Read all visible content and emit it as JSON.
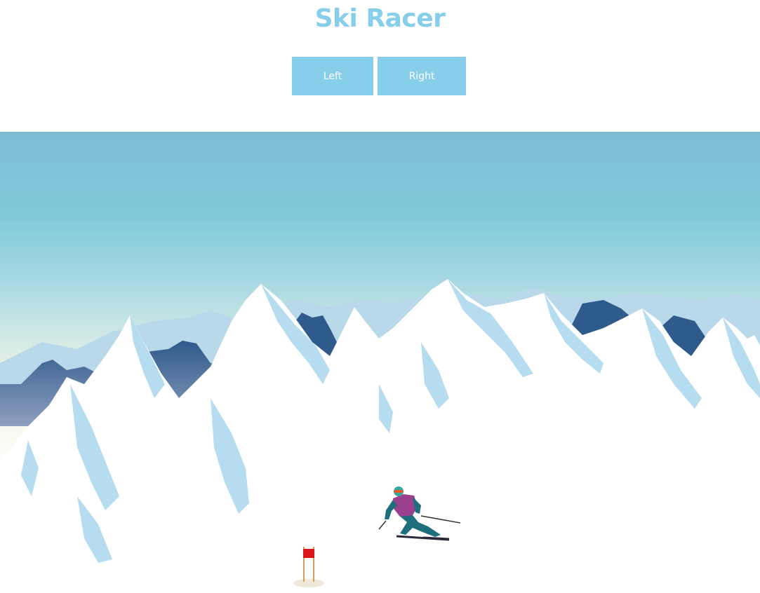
{
  "game": {
    "title": "Ski Racer",
    "controls": {
      "left_label": "Left",
      "right_label": "Right"
    }
  },
  "colors": {
    "accent": "#87ceeb",
    "button_text": "#ffffff",
    "sky_top": "#7fbcd6",
    "sky_mid": "#7fc9da",
    "sky_haze": "#f1f6e3",
    "snow": "#ffffff",
    "ice": "#b5ddef",
    "far_mountain": "#4a6a95",
    "gate_flag": "#d81818"
  },
  "icons": {
    "skier": "skier-icon",
    "gate": "slalom-gate-icon"
  }
}
